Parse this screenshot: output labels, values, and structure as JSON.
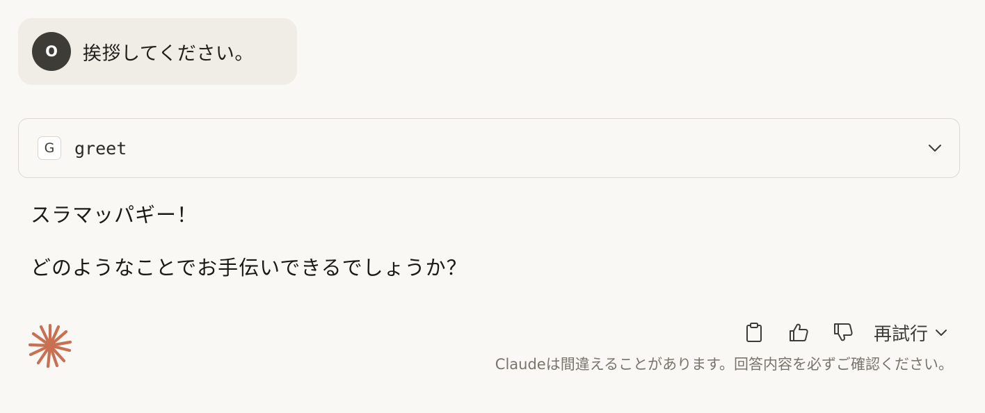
{
  "user_message": {
    "avatar_initial": "O",
    "text": "挨拶してください。"
  },
  "tool_call": {
    "badge": "G",
    "name": "greet",
    "chevron_icon": "chevron-down-icon"
  },
  "assistant_message": {
    "lines": [
      "スラマッパギー！",
      "どのようなことでお手伝いできるでしょうか？"
    ]
  },
  "footer": {
    "logo_icon": "claude-sparkle-icon",
    "actions": {
      "copy_icon": "clipboard-icon",
      "like_icon": "thumbs-up-icon",
      "dislike_icon": "thumbs-down-icon",
      "retry_label": "再試行",
      "retry_chevron_icon": "chevron-down-icon"
    },
    "disclaimer": "Claudeは間違えることがあります。回答内容を必ずご確認ください。"
  },
  "colors": {
    "background": "#faf8f4",
    "user_bubble": "#f0ede6",
    "avatar": "#3d3c37",
    "logo": "#c96f52",
    "border": "#dcd9d0",
    "muted_text": "#77746c"
  }
}
